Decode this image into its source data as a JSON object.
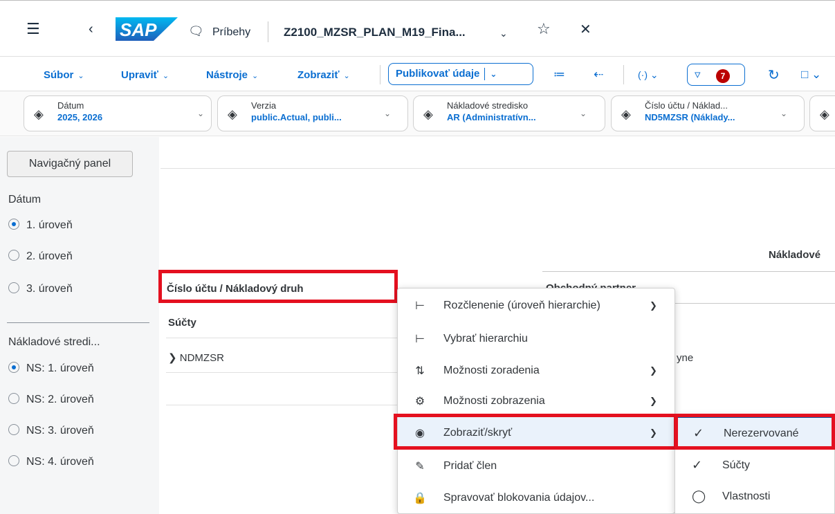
{
  "shell": {
    "logo": "SAP",
    "stories_label": "Príbehy",
    "story_title": "Z2100_MZSR_PLAN_M19_Fina..."
  },
  "toolbar": {
    "menus": [
      "Súbor",
      "Upraviť",
      "Nástroje",
      "Zobraziť"
    ],
    "publish_label": "Publikovať údaje",
    "filter_count": "7"
  },
  "filters": [
    {
      "label": "Dátum",
      "value": "2025, 2026"
    },
    {
      "label": "Verzia",
      "value": "public.Actual, publi..."
    },
    {
      "label": "Nákladové stredisko",
      "value": "AR (Administratívn..."
    },
    {
      "label": "Číslo účtu / Náklad...",
      "value": "ND5MZSR (Náklady..."
    }
  ],
  "nav": {
    "button": "Navigačný panel",
    "groups": [
      {
        "title": "Dátum",
        "options": [
          "1. úroveň",
          "2. úroveň",
          "3. úroveň"
        ],
        "selected": 0
      },
      {
        "title": "Nákladové stredi...",
        "options": [
          "NS: 1. úroveň",
          "NS: 2. úroveň",
          "NS: 3. úroveň",
          "NS: 4. úroveň"
        ],
        "selected": 0
      }
    ]
  },
  "table": {
    "col_header_right": "Nákladové",
    "row_dim_header": "Číslo účtu / Nákladový druh",
    "col_dim_header": "Obchodný partner",
    "totals_label": "Súčty",
    "row1": "NDMZSR",
    "row1_partial": "yne"
  },
  "context_menu": {
    "items": [
      {
        "label": "Rozčlenenie (úroveň hierarchie)",
        "icon": "hierarchy-icon",
        "submenu": true
      },
      {
        "label": "Vybrať hierarchiu",
        "icon": "hierarchy-icon",
        "submenu": false
      },
      {
        "label": "Možnosti zoradenia",
        "icon": "sort-icon",
        "submenu": true
      },
      {
        "label": "Možnosti zobrazenia",
        "icon": "settings-icon",
        "submenu": true
      },
      {
        "label": "Zobraziť/skryť",
        "icon": "eye-icon",
        "submenu": true
      },
      {
        "label": "Pridať člen",
        "icon": "add-member-icon",
        "submenu": false
      },
      {
        "label": "Spravovať blokovania údajov...",
        "icon": "lock-icon",
        "submenu": false
      }
    ]
  },
  "submenu": {
    "items": [
      {
        "label": "Nerezervované",
        "checked": true
      },
      {
        "label": "Súčty",
        "checked": true
      },
      {
        "label": "Vlastnosti",
        "checked": false
      }
    ]
  },
  "colors": {
    "accent": "#0a6ed1",
    "highlight": "#e4101f",
    "badge": "#bb0000"
  }
}
